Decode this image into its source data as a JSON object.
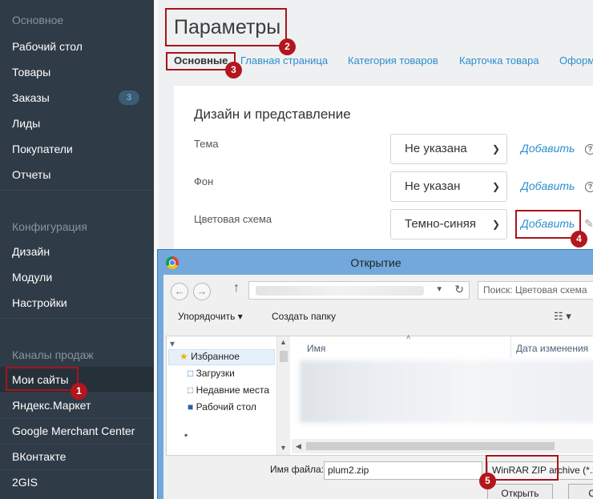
{
  "sidebar": {
    "sections": [
      {
        "heading": "Основное",
        "items": [
          {
            "label": "Рабочий стол"
          },
          {
            "label": "Товары"
          },
          {
            "label": "Заказы",
            "badge": "3"
          },
          {
            "label": "Лиды"
          },
          {
            "label": "Покупатели"
          },
          {
            "label": "Отчеты"
          }
        ]
      },
      {
        "heading": "Конфигурация",
        "items": [
          {
            "label": "Дизайн"
          },
          {
            "label": "Модули"
          },
          {
            "label": "Настройки"
          }
        ]
      },
      {
        "heading": "Каналы продаж",
        "items": [
          {
            "label": "Мои сайты"
          },
          {
            "label": "Яндекс.Маркет"
          },
          {
            "label": "Google Merchant Center"
          },
          {
            "label": "ВКонтакте"
          },
          {
            "label": "2GIS"
          }
        ]
      }
    ]
  },
  "page": {
    "title": "Параметры",
    "tabs": [
      "Основные",
      "Главная страница",
      "Категория товаров",
      "Карточка товара",
      "Оформ"
    ],
    "card_heading": "Дизайн и представление",
    "fields": [
      {
        "label": "Тема",
        "value": "Не указана",
        "add": "Добавить",
        "help": "?"
      },
      {
        "label": "Фон",
        "value": "Не указан",
        "add": "Добавить",
        "help": "?"
      },
      {
        "label": "Цветовая схема",
        "value": "Темно-синяя",
        "add": "Добавить"
      }
    ]
  },
  "markers": [
    "1",
    "2",
    "3",
    "4",
    "5"
  ],
  "dialog": {
    "title": "Открытие",
    "search_placeholder": "Поиск: Цветовая схема",
    "toolbar": {
      "organize": "Упорядочить ▾",
      "new_folder": "Создать папку"
    },
    "tree": [
      "Избранное",
      "Загрузки",
      "Недавние места",
      "Рабочий стол"
    ],
    "columns": {
      "name": "Имя",
      "date": "Дата изменения"
    },
    "filename_label": "Имя файла:",
    "filename_value": "plum2.zip",
    "filetype": "WinRAR ZIP archive (*.zi",
    "open_button": "Открыть",
    "cancel_button": "О"
  }
}
